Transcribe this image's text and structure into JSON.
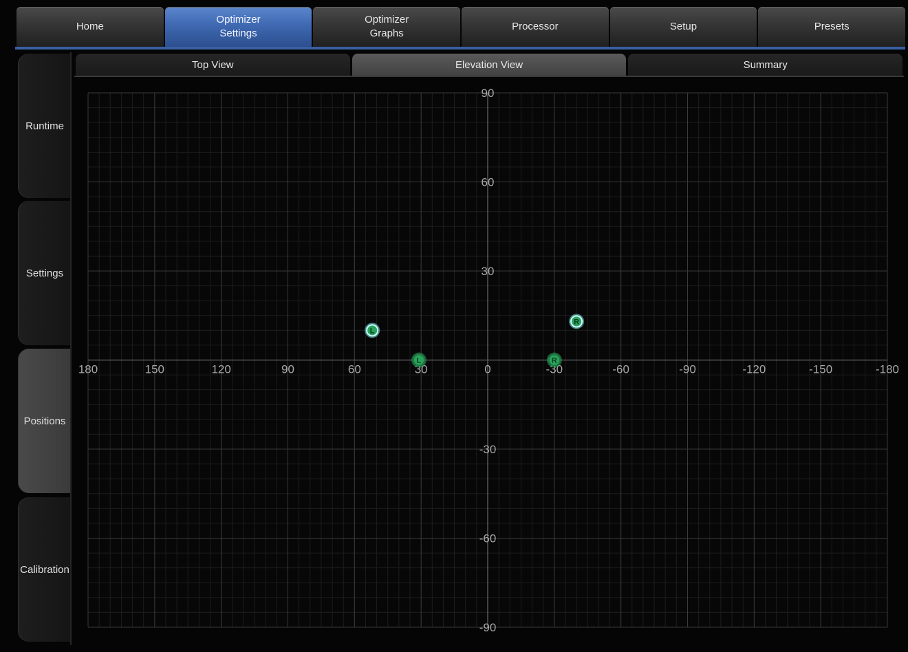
{
  "top_tabs": [
    {
      "label": "Home",
      "active": false
    },
    {
      "label": "Optimizer\nSettings",
      "active": true
    },
    {
      "label": "Optimizer\nGraphs",
      "active": false
    },
    {
      "label": "Processor",
      "active": false
    },
    {
      "label": "Setup",
      "active": false
    },
    {
      "label": "Presets",
      "active": false
    }
  ],
  "side_tabs": [
    {
      "label": "Runtime",
      "active": false
    },
    {
      "label": "Settings",
      "active": false
    },
    {
      "label": "Positions",
      "active": true
    },
    {
      "label": "Calibration",
      "active": false
    }
  ],
  "sub_tabs": [
    {
      "label": "Top View",
      "active": false
    },
    {
      "label": "Elevation View",
      "active": true
    },
    {
      "label": "Summary",
      "active": false
    }
  ],
  "colors": {
    "accent": "#3f69b2",
    "marker_green": "#2aa35a",
    "marker_cyan": "#7fe0e0"
  },
  "chart_data": {
    "type": "scatter",
    "xlim": [
      180,
      -180
    ],
    "ylim": [
      -90,
      90
    ],
    "x_ticks": [
      "180",
      "150",
      "120",
      "90",
      "60",
      "30",
      "0",
      "-30",
      "-60",
      "-90",
      "-120",
      "-150",
      "-180"
    ],
    "y_ticks": [
      "90",
      "60",
      "30",
      "-30",
      "-60",
      "-90"
    ],
    "points": [
      {
        "label": "L",
        "x": 52,
        "y": 10,
        "style": "cyan"
      },
      {
        "label": "R",
        "x": -40,
        "y": 13,
        "style": "cyan"
      },
      {
        "label": "L",
        "x": 31,
        "y": 0,
        "style": "green"
      },
      {
        "label": "R",
        "x": -30,
        "y": 0,
        "style": "green"
      }
    ]
  }
}
